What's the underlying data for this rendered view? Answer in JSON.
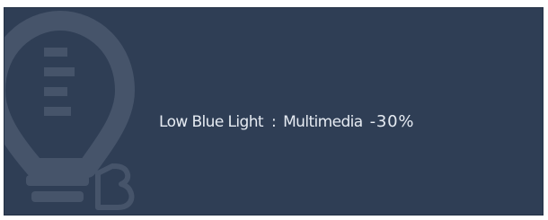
{
  "osd": {
    "feature_label": "Low Blue Light",
    "separator": ":",
    "mode_label": "Multimedia",
    "value": "-30%",
    "background_color": "#2f3e55",
    "logo_icon": "bulb-b-logo-icon"
  }
}
